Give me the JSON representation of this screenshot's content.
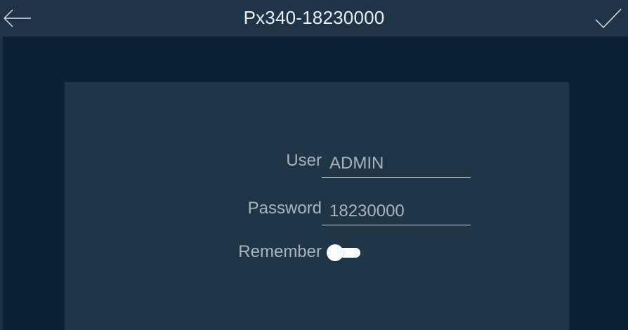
{
  "header": {
    "title": "Px340-18230000",
    "back_icon": "arrow-left-icon",
    "confirm_icon": "checkmark-icon"
  },
  "login_form": {
    "user": {
      "label": "User",
      "value": "ADMIN"
    },
    "password": {
      "label": "Password",
      "value": "18230000"
    },
    "remember": {
      "label": "Remember",
      "enabled": false
    }
  },
  "colors": {
    "background": "#0b2236",
    "titlebar": "#1f3447",
    "panel": "#1f3649",
    "text": "#a8b3bf",
    "title_text": "#e9eef3",
    "toggle": "#ffffff"
  }
}
